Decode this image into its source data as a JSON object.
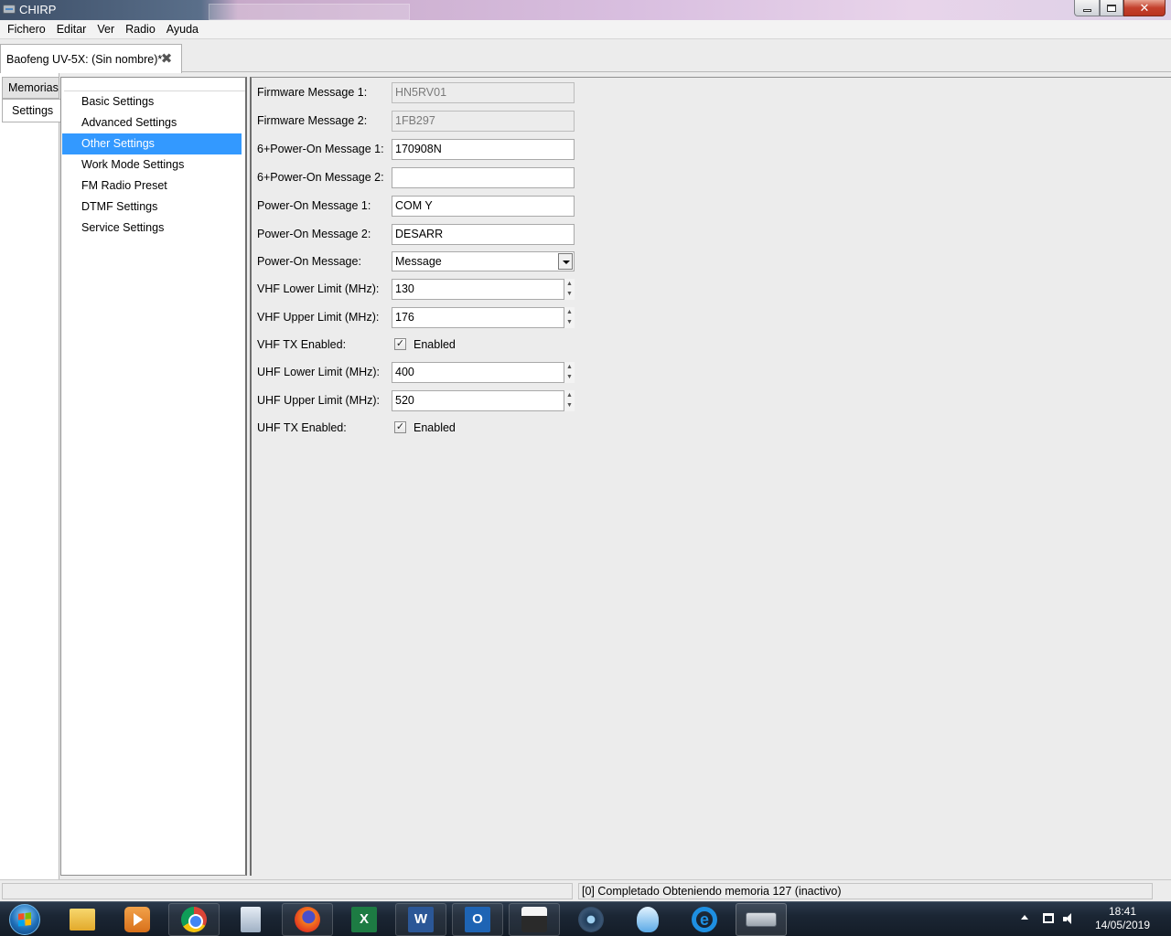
{
  "window": {
    "title": "CHIRP",
    "minimize_label": "",
    "maximize_label": "",
    "close_label": "✕"
  },
  "menubar": {
    "items": [
      "Fichero",
      "Editar",
      "Ver",
      "Radio",
      "Ayuda"
    ]
  },
  "document_tab": {
    "label": "Baofeng UV-5X: (Sin nombre)*",
    "close_glyph": "✖"
  },
  "side_tabs": {
    "memorias": "Memorias",
    "settings": "Settings"
  },
  "tree": {
    "items": [
      "Basic Settings",
      "Advanced Settings",
      "Other Settings",
      "Work Mode Settings",
      "FM Radio Preset",
      "DTMF Settings",
      "Service Settings"
    ],
    "selected_index": 2
  },
  "form": {
    "firmware_message_1": {
      "label": "Firmware Message 1:",
      "value": "HN5RV01"
    },
    "firmware_message_2": {
      "label": "Firmware Message 2:",
      "value": "1FB297"
    },
    "six_power_on_message_1": {
      "label": "6+Power-On Message 1:",
      "value": "170908N"
    },
    "six_power_on_message_2": {
      "label": "6+Power-On Message 2:",
      "value": ""
    },
    "power_on_message_1": {
      "label": "Power-On Message 1:",
      "value": "COM Y"
    },
    "power_on_message_2": {
      "label": "Power-On Message 2:",
      "value": "DESARR"
    },
    "power_on_message": {
      "label": "Power-On Message:",
      "value": "Message"
    },
    "vhf_lower_limit": {
      "label": "VHF Lower Limit (MHz):",
      "value": "130"
    },
    "vhf_upper_limit": {
      "label": "VHF Upper Limit (MHz):",
      "value": "176"
    },
    "vhf_tx_enabled": {
      "label": "VHF TX Enabled:",
      "checkbox_label": "Enabled",
      "checked": true
    },
    "uhf_lower_limit": {
      "label": "UHF Lower Limit (MHz):",
      "value": "400"
    },
    "uhf_upper_limit": {
      "label": "UHF Upper Limit (MHz):",
      "value": "520"
    },
    "uhf_tx_enabled": {
      "label": "UHF TX Enabled:",
      "checkbox_label": "Enabled",
      "checked": true
    },
    "check_glyph": "✓",
    "spin_up": "▲",
    "spin_down": "▼"
  },
  "statusbar": {
    "left": "",
    "right": "[0] Completado Obteniendo memoria 127 (inactivo)"
  },
  "taskbar": {
    "apps": [
      "folder-icon",
      "media-player-icon",
      "chrome-icon",
      "calculator-icon",
      "firefox-icon",
      "excel-icon",
      "word-icon",
      "outlook-icon",
      "calculator-app-icon",
      "camera-icon",
      "rocket-icon",
      "internet-explorer-icon",
      "serial-port-icon"
    ],
    "excel_letter": "X",
    "word_letter": "W",
    "outlook_letter": "O",
    "ie_letter": "e",
    "clock_time": "18:41",
    "clock_date": "14/05/2019"
  },
  "colors": {
    "selection": "#3399ff",
    "window_bg": "#ececec"
  }
}
